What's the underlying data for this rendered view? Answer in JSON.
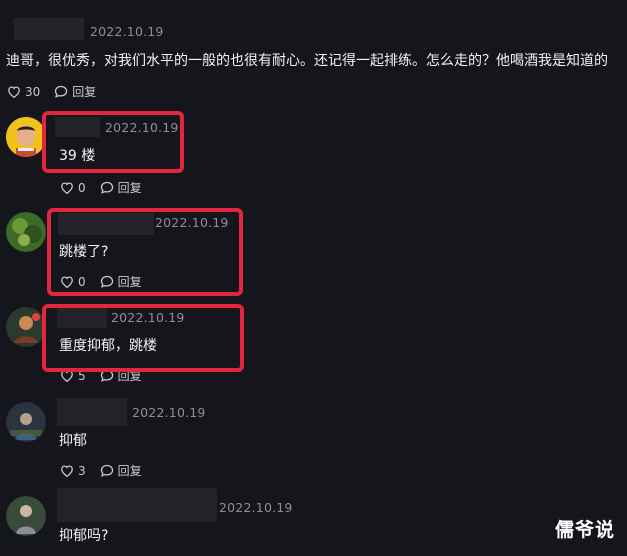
{
  "comments": [
    {
      "date": "2022.10.19",
      "text": "迪哥，很优秀，对我们水平的一般的也很有耐心。还记得一起排练。怎么走的？他喝酒我是知道的",
      "likes": "30",
      "reply_label": "回复"
    },
    {
      "date": "2022.10.19",
      "text": "39 楼",
      "likes": "0",
      "reply_label": "回复"
    },
    {
      "date": "2022.10.19",
      "text": "跳楼了?",
      "likes": "0",
      "reply_label": "回复"
    },
    {
      "date": "2022.10.19",
      "text": "重度抑郁，跳楼",
      "likes": "5",
      "reply_label": "回复"
    },
    {
      "date": "2022.10.19",
      "text": "抑郁",
      "likes": "3",
      "reply_label": "回复"
    },
    {
      "date": "2022.10.19",
      "text": "抑郁吗?"
    }
  ],
  "watermark": "儒爷说",
  "colors": {
    "background": "#15161c",
    "highlight": "#e3263d",
    "muted": "#8e8f96"
  }
}
